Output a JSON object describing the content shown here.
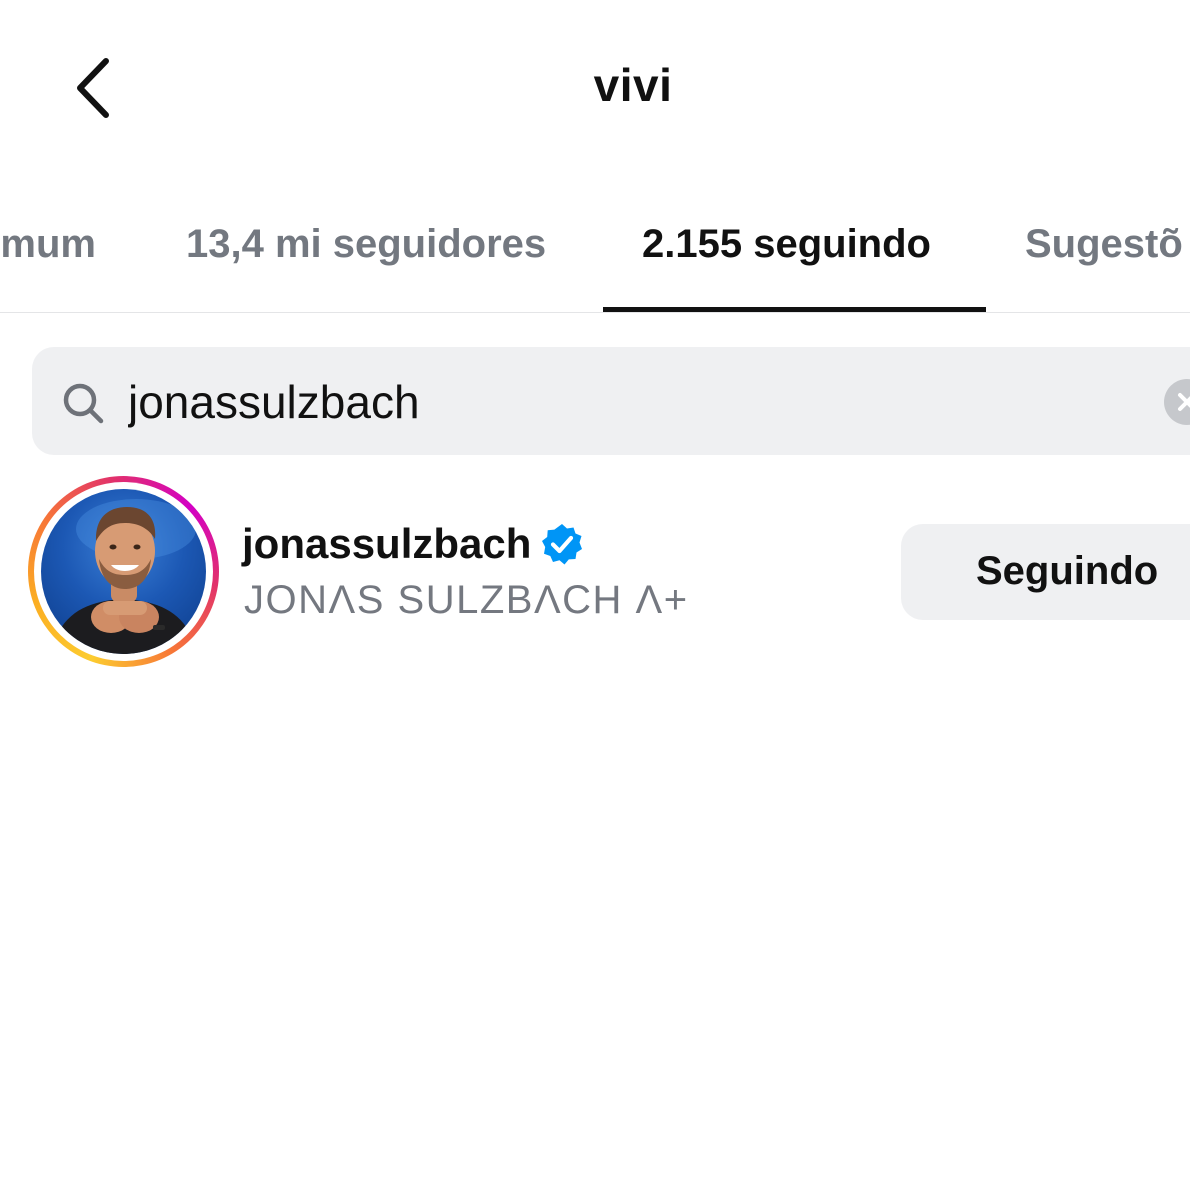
{
  "header": {
    "title": "vivi"
  },
  "tabs": [
    {
      "label": "omum",
      "active": false
    },
    {
      "label": "13,4 mi seguidores",
      "active": false
    },
    {
      "label": "2.155 seguindo",
      "active": true
    },
    {
      "label": "Sugestõ",
      "active": false
    }
  ],
  "search": {
    "value": "jonassulzbach"
  },
  "results": [
    {
      "username": "jonassulzbach",
      "full_name": "JONΛS SULZBΛCH Λ+",
      "verified": true,
      "story_ring": true,
      "button_label": "Seguindo"
    }
  ],
  "colors": {
    "text_primary": "#111111",
    "text_secondary": "#747880",
    "field_background": "#eff0f2",
    "verified_blue": "#0095f6",
    "story_ring": [
      "#fccc30",
      "#f77737",
      "#e1306c",
      "#d300c5"
    ]
  },
  "icons": {
    "back": "chevron-left-icon",
    "search": "search-icon",
    "clear": "clear-circle-icon",
    "verified": "verified-badge-icon"
  }
}
